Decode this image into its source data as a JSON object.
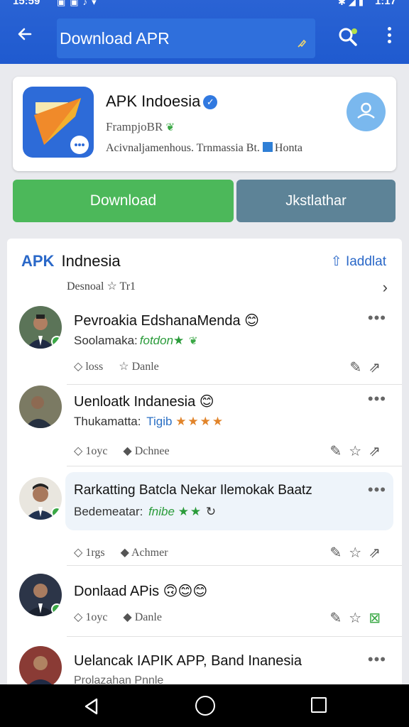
{
  "status_bar": {
    "time": "15:59",
    "right_time": "1:17"
  },
  "app_bar": {
    "title": "Download APR"
  },
  "app_card": {
    "name": "APK Indoesia",
    "developer": "FrampjoBR",
    "meta": "Acivnaljamenhous. Trnmassia Bt.",
    "meta_tag": "Honta"
  },
  "buttons": {
    "download": "Download",
    "secondary": "Jkstlathar"
  },
  "feed": {
    "brand": "APK",
    "title": "Indnesia",
    "action": "Iaddlat",
    "subtitle": "Desnoal",
    "subtitle_tag": "Tr1",
    "posts": [
      {
        "title": "Pevroakia EdshanaMenda",
        "sub": "Soolamaka:",
        "tag": "fotdon",
        "tag_style": "green",
        "stars": "★",
        "star_color": "green",
        "meta_a": "loss",
        "meta_b": "Danle"
      },
      {
        "title": "Uenloatk Indanesia",
        "sub": "Thukamatta:",
        "tag": "Tigib",
        "tag_style": "blue",
        "stars": "★★★★",
        "star_color": "orange",
        "meta_a": "1oyc",
        "meta_b": "Dchnee"
      },
      {
        "title": "Rarkatting Batcla Nekar Ilemokak Baatz",
        "sub": "Bedemeatar:",
        "tag": "fnibe",
        "tag_style": "green",
        "stars": "★★",
        "star_color": "green",
        "meta_a": "1rgs",
        "meta_b": "Achmer"
      },
      {
        "title": "Donlaad APis",
        "sub": "",
        "tag": "",
        "tag_style": "green",
        "stars": "",
        "star_color": "green",
        "meta_a": "1oyc",
        "meta_b": "Danle"
      },
      {
        "title": "Uelancak IAPIK APP, Band Inanesia",
        "sub": "Prolazahan Pnnle",
        "tag": "",
        "tag_style": "green",
        "stars": "",
        "star_color": "green",
        "meta_a": "",
        "meta_b": ""
      }
    ]
  },
  "colors": {
    "app_bar": "#1f5acf",
    "download": "#4cb85a",
    "secondary": "#5d8397",
    "accent": "#2a68c8"
  }
}
